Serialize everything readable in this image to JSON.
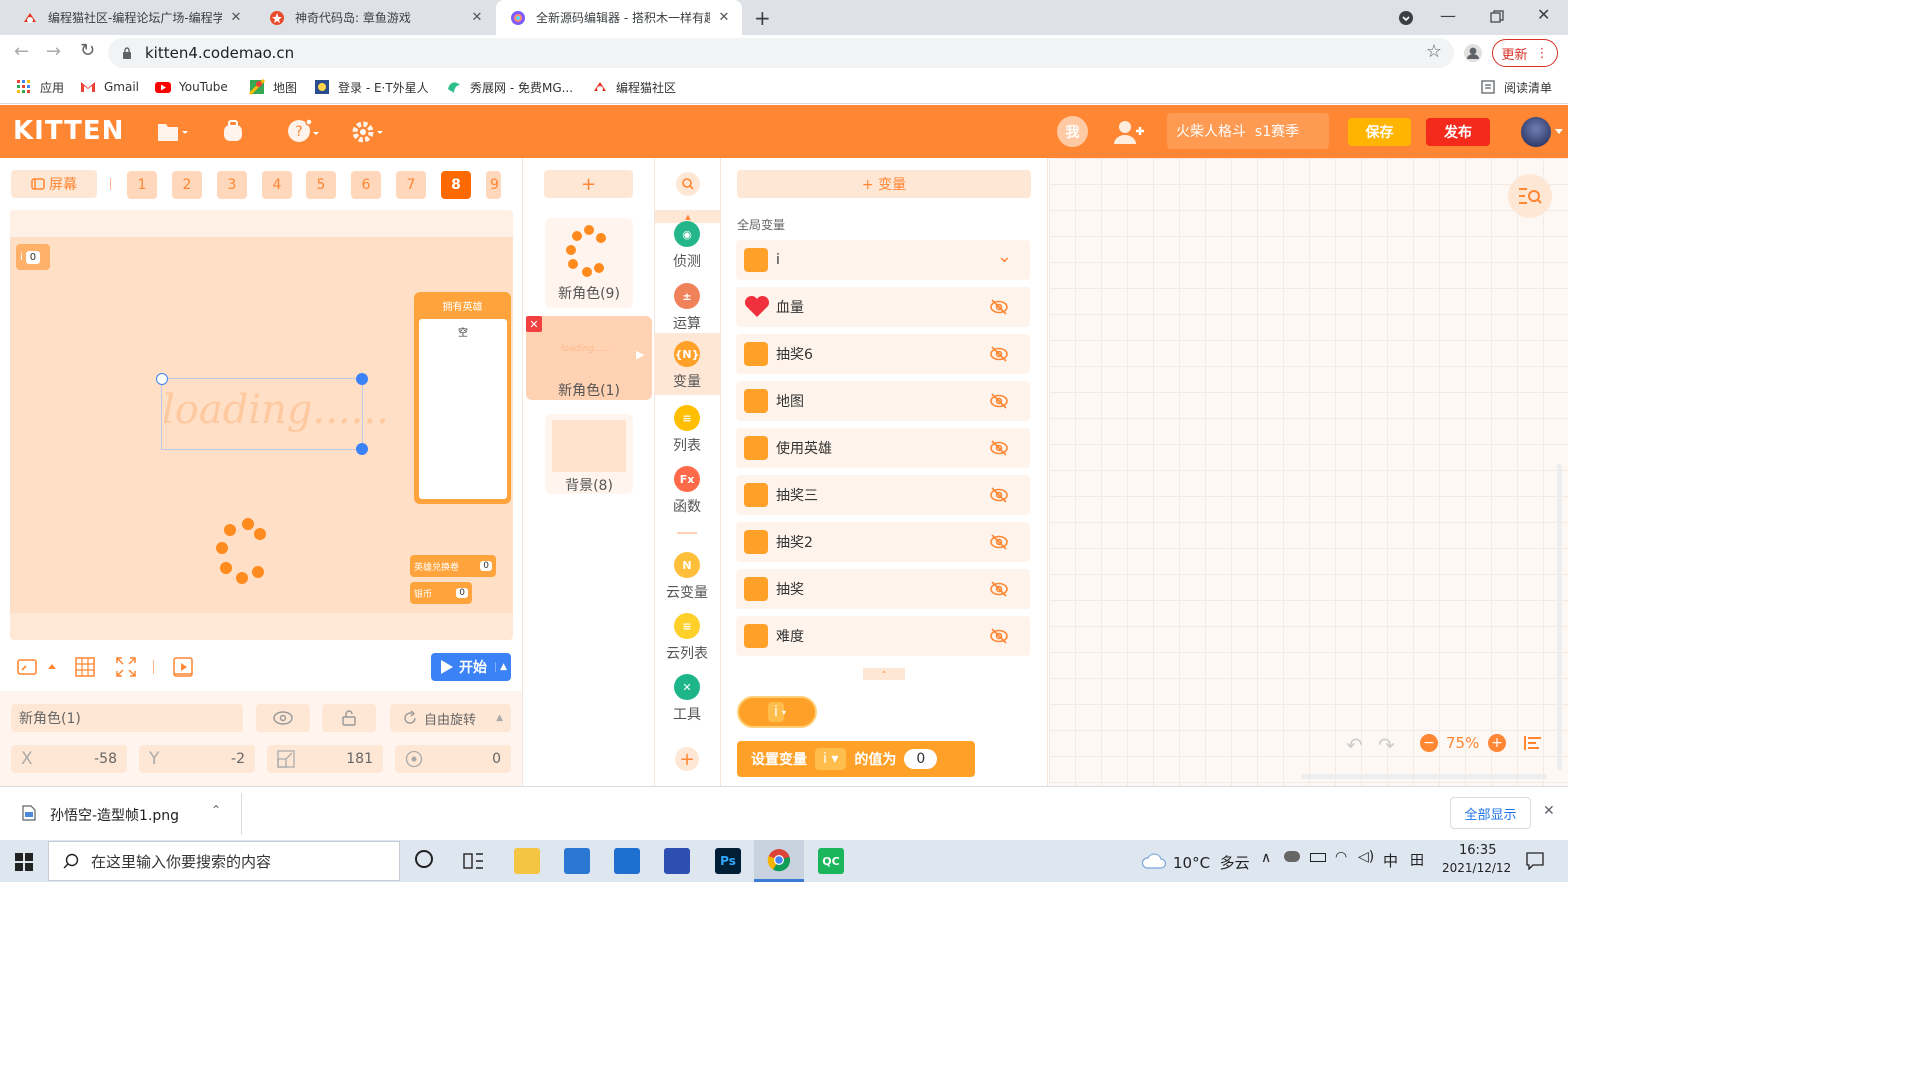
{
  "browser": {
    "tabs": [
      {
        "title": "编程猫社区-编程论坛广场-编程学...",
        "active": false
      },
      {
        "title": "神奇代码岛: 章鱼游戏",
        "active": false
      },
      {
        "title": "全新源码编辑器 - 搭积木一样有趣...",
        "active": true
      }
    ],
    "url": "kitten4.codemao.cn",
    "update_label": "更新",
    "bookmarks": [
      {
        "label": "应用",
        "icon": "apps-grid-icon"
      },
      {
        "label": "Gmail",
        "icon": "gmail-icon"
      },
      {
        "label": "YouTube",
        "icon": "youtube-icon"
      },
      {
        "label": "地图",
        "icon": "maps-icon"
      },
      {
        "label": "登录 - E·T外星人",
        "icon": "et-icon"
      },
      {
        "label": "秀展网 - 免费MG...",
        "icon": "xiuzhan-icon"
      },
      {
        "label": "编程猫社区",
        "icon": "codemao-icon"
      }
    ],
    "reading_list": "阅读清单"
  },
  "app": {
    "logo": "KITTEN",
    "avatar_label": "我",
    "project_title": "火柴人格斗  s1赛季",
    "save_label": "保存",
    "publish_label": "发布",
    "accent": "#ff8632"
  },
  "stage": {
    "screen_label": "屏幕",
    "screen_tabs": [
      "1",
      "2",
      "3",
      "4",
      "5",
      "6",
      "7",
      "8",
      "9"
    ],
    "active_screen": "8",
    "var_monitor": {
      "name": "i",
      "value": "0"
    },
    "loading_text": "loading......",
    "hero_list": {
      "title": "拥有英雄",
      "item": "空"
    },
    "small_monitors": [
      {
        "name": "英雄兑换卷",
        "value": "0"
      },
      {
        "name": "银币",
        "value": "0"
      }
    ],
    "start_label": "开始",
    "sprite": {
      "name": "新角色(1)",
      "rotate_label": "自由旋转",
      "x_label": "X",
      "x": "-58",
      "y_label": "Y",
      "y": "-2",
      "size": "181",
      "direction": "0"
    }
  },
  "sprites": {
    "add_label": "+",
    "items": [
      {
        "name": "新角色(9)",
        "selected": false
      },
      {
        "name": "新角色(1)",
        "selected": true,
        "thumb_text": "loading......"
      },
      {
        "name": "背景(8)",
        "selected": false
      }
    ]
  },
  "categories": [
    {
      "label": "侦测",
      "color": "#24b58a",
      "icon": "detect-icon",
      "glyph": "◉"
    },
    {
      "label": "运算",
      "color": "#f0825a",
      "icon": "math-icon",
      "glyph": "±"
    },
    {
      "label": "变量",
      "color": "#ffa028",
      "icon": "variable-icon",
      "glyph": "{N}"
    },
    {
      "label": "列表",
      "color": "#ffbf00",
      "icon": "list-icon",
      "glyph": "≡"
    },
    {
      "label": "函数",
      "color": "#ff6b4a",
      "icon": "function-icon",
      "glyph": "Fx"
    },
    {
      "label": "云变量",
      "color": "#ffbf3a",
      "icon": "cloud-variable-icon",
      "glyph": "N"
    },
    {
      "label": "云列表",
      "color": "#ffcf2a",
      "icon": "cloud-list-icon",
      "glyph": "≡"
    },
    {
      "label": "工具",
      "color": "#1fb58a",
      "icon": "tools-icon",
      "glyph": "✕"
    }
  ],
  "variables": {
    "add_label": "+ 变量",
    "section_label": "全局变量",
    "items": [
      "i",
      "血量",
      "抽奖6",
      "地图",
      "使用英雄",
      "抽奖三",
      "抽奖2",
      "抽奖",
      "难度"
    ],
    "block_var": "i",
    "set_block": {
      "prefix": "设置变量",
      "var": "i",
      "mid": "的值为",
      "value": "0"
    }
  },
  "workspace": {
    "zoom": "75%"
  },
  "downloads": {
    "file": "孙悟空-造型帧1.png",
    "show_all": "全部显示"
  },
  "taskbar": {
    "search_placeholder": "在这里输入你要搜索的内容",
    "weather": "10°C  多云",
    "ime": "中",
    "time": "16:35",
    "date": "2021/12/12"
  }
}
